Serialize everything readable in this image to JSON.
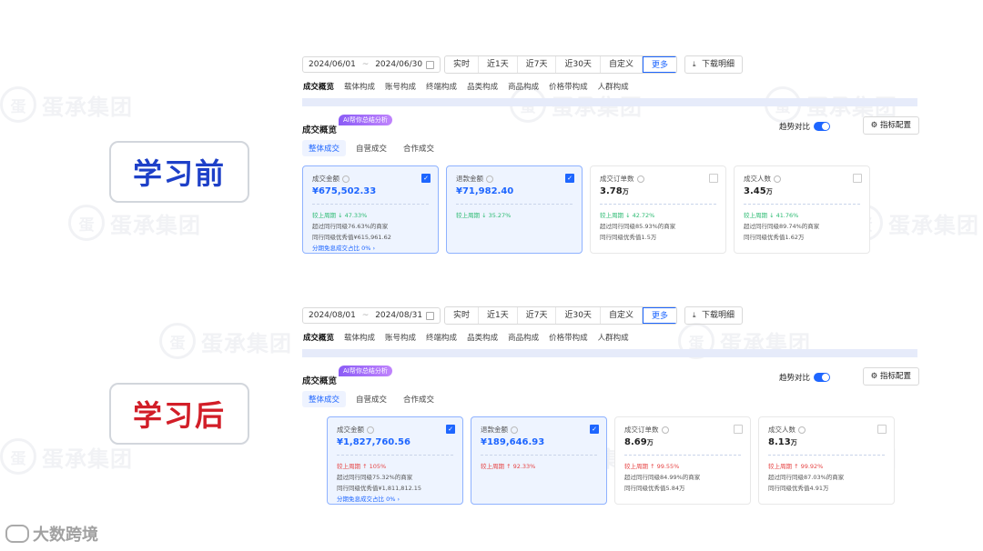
{
  "watermark": {
    "seal": "蛋",
    "text": "蛋承集团"
  },
  "labels": {
    "before": "学习前",
    "after": "学习后",
    "before_color": "#1e40c8",
    "after_color": "#d21e28"
  },
  "brand": {
    "name": "大数跨境"
  },
  "colors": {
    "accent": "#1e66ff",
    "up": "#e64545",
    "down": "#2dbb73"
  },
  "before": {
    "date_start": "2024/06/01",
    "date_end": "2024/06/30",
    "ranges": [
      "实时",
      "近1天",
      "近7天",
      "近30天",
      "自定义",
      "更多"
    ],
    "download": "下载明细",
    "tabs": [
      "成交概览",
      "载体构成",
      "账号构成",
      "终端构成",
      "品类构成",
      "商品构成",
      "价格带构成",
      "人群构成"
    ],
    "section_title": "成交概览",
    "ai_tag": "AI帮你总结分析",
    "trend": "趋势对比",
    "config": "指标配置",
    "subtabs": [
      "整体成交",
      "自营成交",
      "合作成交"
    ],
    "cards": [
      {
        "name": "成交金额",
        "value": "¥675,502.33",
        "unit": "",
        "selected": true,
        "line1": "较上周期 ↓ 47.33%",
        "line2": "超过同行同级76.63%的商家",
        "line3": "同行同级优秀值¥615,961.62",
        "line4": "分期免息成交占比 0% ›"
      },
      {
        "name": "退款金额",
        "value": "¥71,982.40",
        "unit": "",
        "selected": true,
        "line1": "较上周期 ↓ 35.27%"
      },
      {
        "name": "成交订单数",
        "value": "3.78",
        "unit": "万",
        "selected": false,
        "line1": "较上周期 ↓ 42.72%",
        "line2": "超过同行同级85.93%的商家",
        "line3": "同行同级优秀值1.5万"
      },
      {
        "name": "成交人数",
        "value": "3.45",
        "unit": "万",
        "selected": false,
        "line1": "较上周期 ↓ 41.76%",
        "line2": "超过同行同级89.74%的商家",
        "line3": "同行同级优秀值1.62万"
      }
    ]
  },
  "after": {
    "date_start": "2024/08/01",
    "date_end": "2024/08/31",
    "ranges": [
      "实时",
      "近1天",
      "近7天",
      "近30天",
      "自定义",
      "更多"
    ],
    "download": "下载明细",
    "tabs": [
      "成交概览",
      "载体构成",
      "账号构成",
      "终端构成",
      "品类构成",
      "商品构成",
      "价格带构成",
      "人群构成"
    ],
    "section_title": "成交概览",
    "ai_tag": "AI帮你总结分析",
    "trend": "趋势对比",
    "config": "指标配置",
    "subtabs": [
      "整体成交",
      "自营成交",
      "合作成交"
    ],
    "cards": [
      {
        "name": "成交金额",
        "value": "¥1,827,760.56",
        "unit": "",
        "selected": true,
        "line1": "较上周期 ↑ 105%",
        "line2": "超过同行同级75.32%的商家",
        "line3": "同行同级优秀值¥1,811,812.15",
        "line4": "分期免息成交占比 0% ›"
      },
      {
        "name": "退款金额",
        "value": "¥189,646.93",
        "unit": "",
        "selected": true,
        "line1": "较上周期 ↑ 92.33%"
      },
      {
        "name": "成交订单数",
        "value": "8.69",
        "unit": "万",
        "selected": false,
        "line1": "较上周期 ↑ 99.55%",
        "line2": "超过同行同级84.99%的商家",
        "line3": "同行同级优秀值5.84万"
      },
      {
        "name": "成交人数",
        "value": "8.13",
        "unit": "万",
        "selected": false,
        "line1": "较上周期 ↑ 99.92%",
        "line2": "超过同行同级87.03%的商家",
        "line3": "同行同级优秀值4.91万"
      }
    ]
  }
}
